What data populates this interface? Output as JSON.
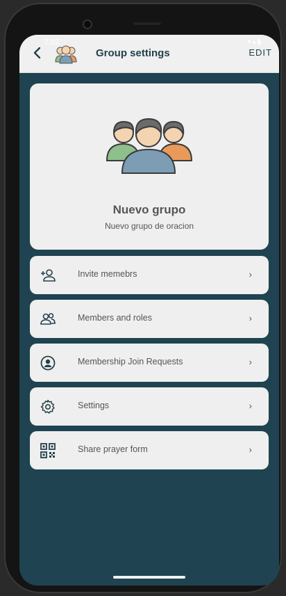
{
  "status_bar": {
    "time": "7:02",
    "icons": "▾▴▮"
  },
  "header": {
    "title": "Group settings",
    "edit_label": "EDIT"
  },
  "group": {
    "name": "Nuevo grupo",
    "description": "Nuevo grupo de oracion"
  },
  "menu": [
    {
      "label": "Invite memebrs",
      "icon": "add-person-icon"
    },
    {
      "label": "Members and roles",
      "icon": "people-icon"
    },
    {
      "label": "Membership Join Requests",
      "icon": "account-circle-icon"
    },
    {
      "label": "Settings",
      "icon": "gear-icon"
    },
    {
      "label": "Share prayer form",
      "icon": "qr-code-icon"
    }
  ],
  "chevron": "›",
  "colors": {
    "background": "#1f4350",
    "card": "#efefef",
    "title": "#23404c"
  }
}
